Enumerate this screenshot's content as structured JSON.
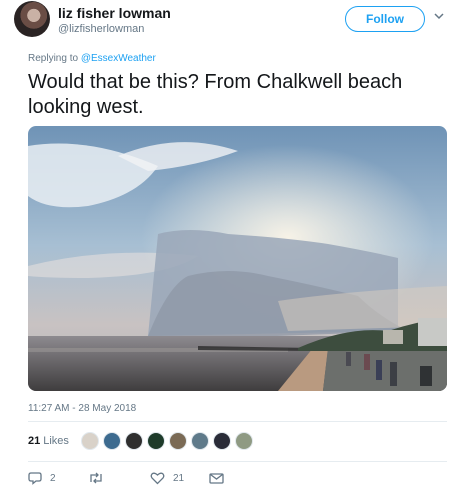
{
  "user": {
    "display_name": "liz fisher lowman",
    "handle": "@lizfisherlowman"
  },
  "follow_label": "Follow",
  "reply": {
    "prefix": "Replying to",
    "target": "@EssexWeather"
  },
  "tweet": {
    "text": "Would that be this? From Chalkwell beach looking west.",
    "timestamp": "11:27 AM - 28 May 2018"
  },
  "stats": {
    "likes_count": "21",
    "likes_label": "Likes"
  },
  "actions": {
    "reply_count": "2",
    "retweet_count": "",
    "like_count": "21"
  },
  "colors": {
    "accent": "#1da1f2",
    "secondary_text": "#657786",
    "divider": "#e6ecf0"
  },
  "icons": [
    "chevron-down-icon",
    "reply-icon",
    "retweet-icon",
    "heart-icon",
    "message-icon"
  ]
}
